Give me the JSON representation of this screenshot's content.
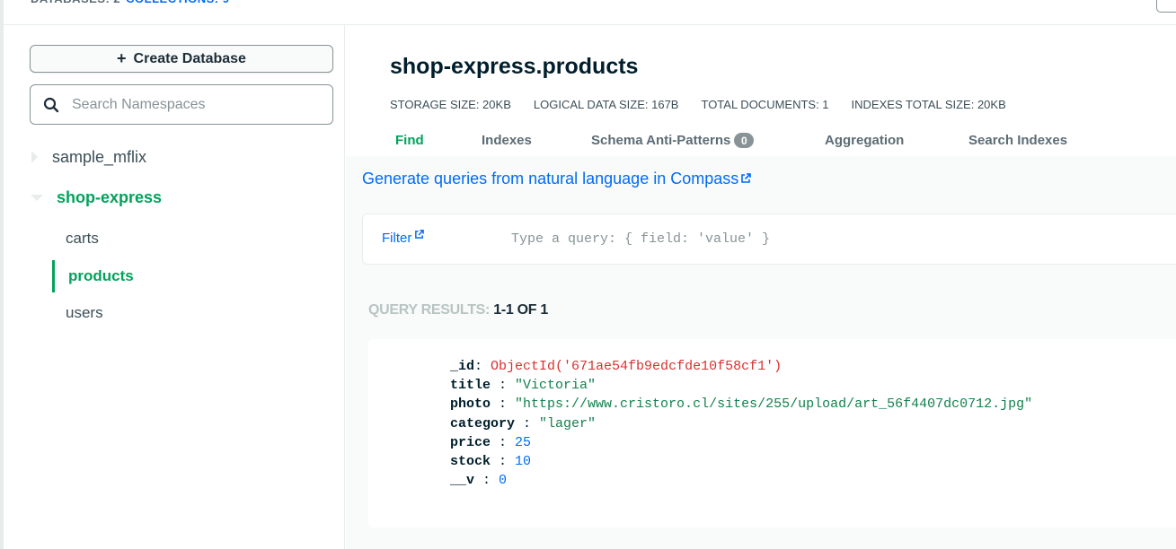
{
  "colors": {
    "accent_green": "#00a35c",
    "link_blue": "#016bf8",
    "objectid_red": "#db3030",
    "string_green": "#12824d",
    "number_blue": "#016bf8"
  },
  "sidebar": {
    "create_button": "Create Database",
    "search_placeholder": "Search Namespaces",
    "databases": [
      {
        "name": "sample_mflix",
        "expanded": false
      },
      {
        "name": "shop-express",
        "expanded": true,
        "collections": [
          "carts",
          "products",
          "users"
        ],
        "selected": "products"
      }
    ]
  },
  "collection": {
    "title": "shop-express.products",
    "stats": {
      "storage_size": "STORAGE SIZE: 20KB",
      "logical_data_size": "LOGICAL DATA SIZE: 167B",
      "total_documents": "TOTAL DOCUMENTS: 1",
      "indexes_total_size": "INDEXES TOTAL SIZE: 20KB"
    }
  },
  "tabs": {
    "find": "Find",
    "indexes": "Indexes",
    "schema": "Schema Anti-Patterns",
    "schema_badge": "0",
    "aggregation": "Aggregation",
    "search_indexes": "Search Indexes"
  },
  "query": {
    "nl_link": "Generate queries from natural language in Compass",
    "filter_label": "Filter",
    "filter_placeholder": "Type a query: { field: 'value' }",
    "results_label": "QUERY RESULTS:",
    "results_count": "1-1 OF 1"
  },
  "document": {
    "fields": [
      {
        "key": "_id",
        "colon": ":",
        "value": "ObjectId('671ae54fb9edcfde10f58cf1')",
        "type": "oid"
      },
      {
        "key": "title",
        "colon": " :",
        "value": "\"Victoria\"",
        "type": "str"
      },
      {
        "key": "photo",
        "colon": " :",
        "value": "\"https://www.cristoro.cl/sites/255/upload/art_56f4407dc0712.jpg\"",
        "type": "str"
      },
      {
        "key": "category",
        "colon": " :",
        "value": "\"lager\"",
        "type": "str"
      },
      {
        "key": "price",
        "colon": " :",
        "value": "25",
        "type": "num"
      },
      {
        "key": "stock",
        "colon": " :",
        "value": "10",
        "type": "num"
      },
      {
        "key": "__v",
        "colon": " :",
        "value": "0",
        "type": "num"
      }
    ]
  }
}
